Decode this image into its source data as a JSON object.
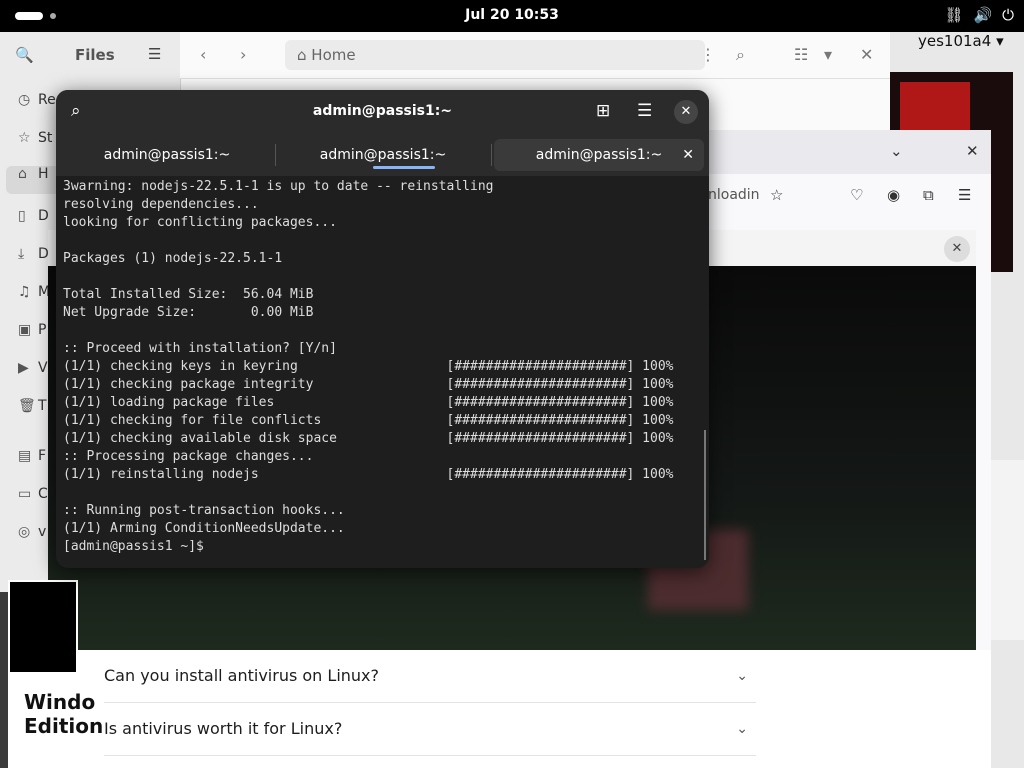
{
  "topbar": {
    "clock": "Jul 20  10:53"
  },
  "files": {
    "title": "Files",
    "location": "Home",
    "sidebar_items": [
      "Re",
      "St",
      "H",
      "D",
      "D",
      "M",
      "P",
      "V",
      "T",
      "F",
      "C",
      "v"
    ]
  },
  "user_menu": {
    "username": "yes101a4"
  },
  "browser": {
    "url_fragment": "nloadin"
  },
  "web": {
    "faq": [
      "Can you install antivirus on Linux?",
      "Is antivirus worth it for Linux?"
    ]
  },
  "thumb": {
    "text_line1": "Windo",
    "text_line2": "Edition"
  },
  "terminal": {
    "title": "admin@passis1:~",
    "tabs": [
      "admin@passis1:~",
      "admin@passis1:~",
      "admin@passis1:~"
    ],
    "lines": [
      "3warning: nodejs-22.5.1-1 is up to date -- reinstalling",
      "resolving dependencies...",
      "looking for conflicting packages...",
      "",
      "Packages (1) nodejs-22.5.1-1",
      "",
      "Total Installed Size:  56.04 MiB",
      "Net Upgrade Size:       0.00 MiB",
      "",
      ":: Proceed with installation? [Y/n]",
      "(1/1) checking keys in keyring                   [######################] 100%",
      "(1/1) checking package integrity                 [######################] 100%",
      "(1/1) loading package files                      [######################] 100%",
      "(1/1) checking for file conflicts                [######################] 100%",
      "(1/1) checking available disk space              [######################] 100%",
      ":: Processing package changes...",
      "(1/1) reinstalling nodejs                        [######################] 100%",
      "",
      ":: Running post-transaction hooks...",
      "(1/1) Arming ConditionNeedsUpdate...",
      "[admin@passis1 ~]$ "
    ]
  }
}
